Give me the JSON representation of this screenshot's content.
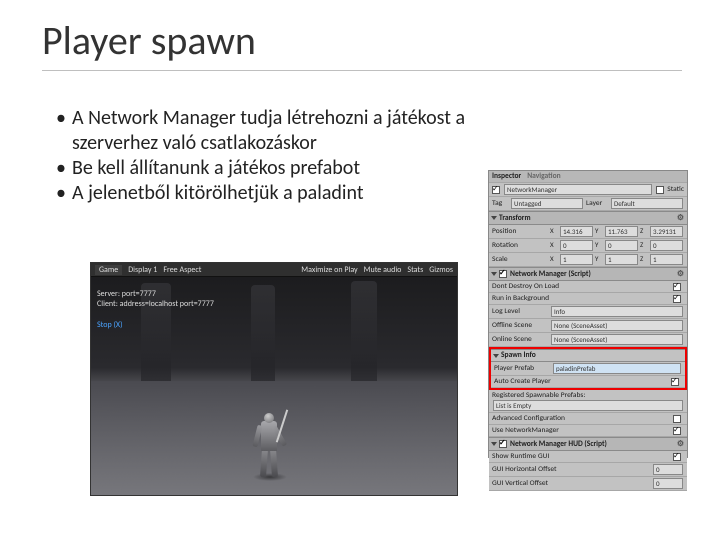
{
  "title": "Player spawn",
  "bullets": [
    "A Network Manager tudja létrehozni a játékost a szerverhez való csatlakozáskor",
    "Be kell állítanunk a játékos prefabot",
    "A jelenetből kitörölhetjük a paladint"
  ],
  "inspector": {
    "tab1": "Inspector",
    "tab2": "Navigation",
    "objectName": "NetworkManager",
    "static": "Static",
    "tagLabel": "Tag",
    "tagValue": "Untagged",
    "layerLabel": "Layer",
    "layerValue": "Default",
    "transform": {
      "title": "Transform",
      "positionLabel": "Position",
      "position": {
        "x": "14.316",
        "y": "11.763",
        "z": "3.29131"
      },
      "rotationLabel": "Rotation",
      "rotation": {
        "x": "0",
        "y": "0",
        "z": "0"
      },
      "scaleLabel": "Scale",
      "scale": {
        "x": "1",
        "y": "1",
        "z": "1"
      }
    },
    "networkManager": {
      "title": "Network Manager (Script)",
      "dontDestroy": "Dont Destroy On Load",
      "runBackground": "Run in Background",
      "logLevelLabel": "Log Level",
      "logLevelValue": "Info",
      "offlineSceneLabel": "Offline Scene",
      "offlineSceneValue": "None (SceneAsset)",
      "onlineSceneLabel": "Online Scene",
      "onlineSceneValue": "None (SceneAsset)",
      "spawnInfo": "Spawn Info",
      "playerPrefabLabel": "Player Prefab",
      "playerPrefabValue": "paladinPrefab",
      "autoCreateLabel": "Auto Create Player",
      "registeredLabel": "Registered Spawnable Prefabs:",
      "listEmpty": "List is Empty",
      "advancedLabel": "Advanced Configuration",
      "useNetworkLabel": "Use NetworkManager"
    },
    "hud": {
      "title": "Network Manager HUD (Script)",
      "showGui": "Show Runtime GUI",
      "offsetX": "GUI Horizontal Offset",
      "offsetXVal": "0",
      "offsetY": "GUI Vertical Offset",
      "offsetYVal": "0"
    }
  },
  "game": {
    "tab": "Game",
    "toolbar1": "Display 1",
    "toolbar2": "Free Aspect",
    "toolbar3": "Maximize on Play",
    "toolbar4": "Mute audio",
    "toolbar5": "Stats",
    "toolbar6": "Gizmos",
    "line1": "Server: port=7777",
    "line2": "Client: address=localhost port=7777",
    "line3": "Stop (X)"
  }
}
